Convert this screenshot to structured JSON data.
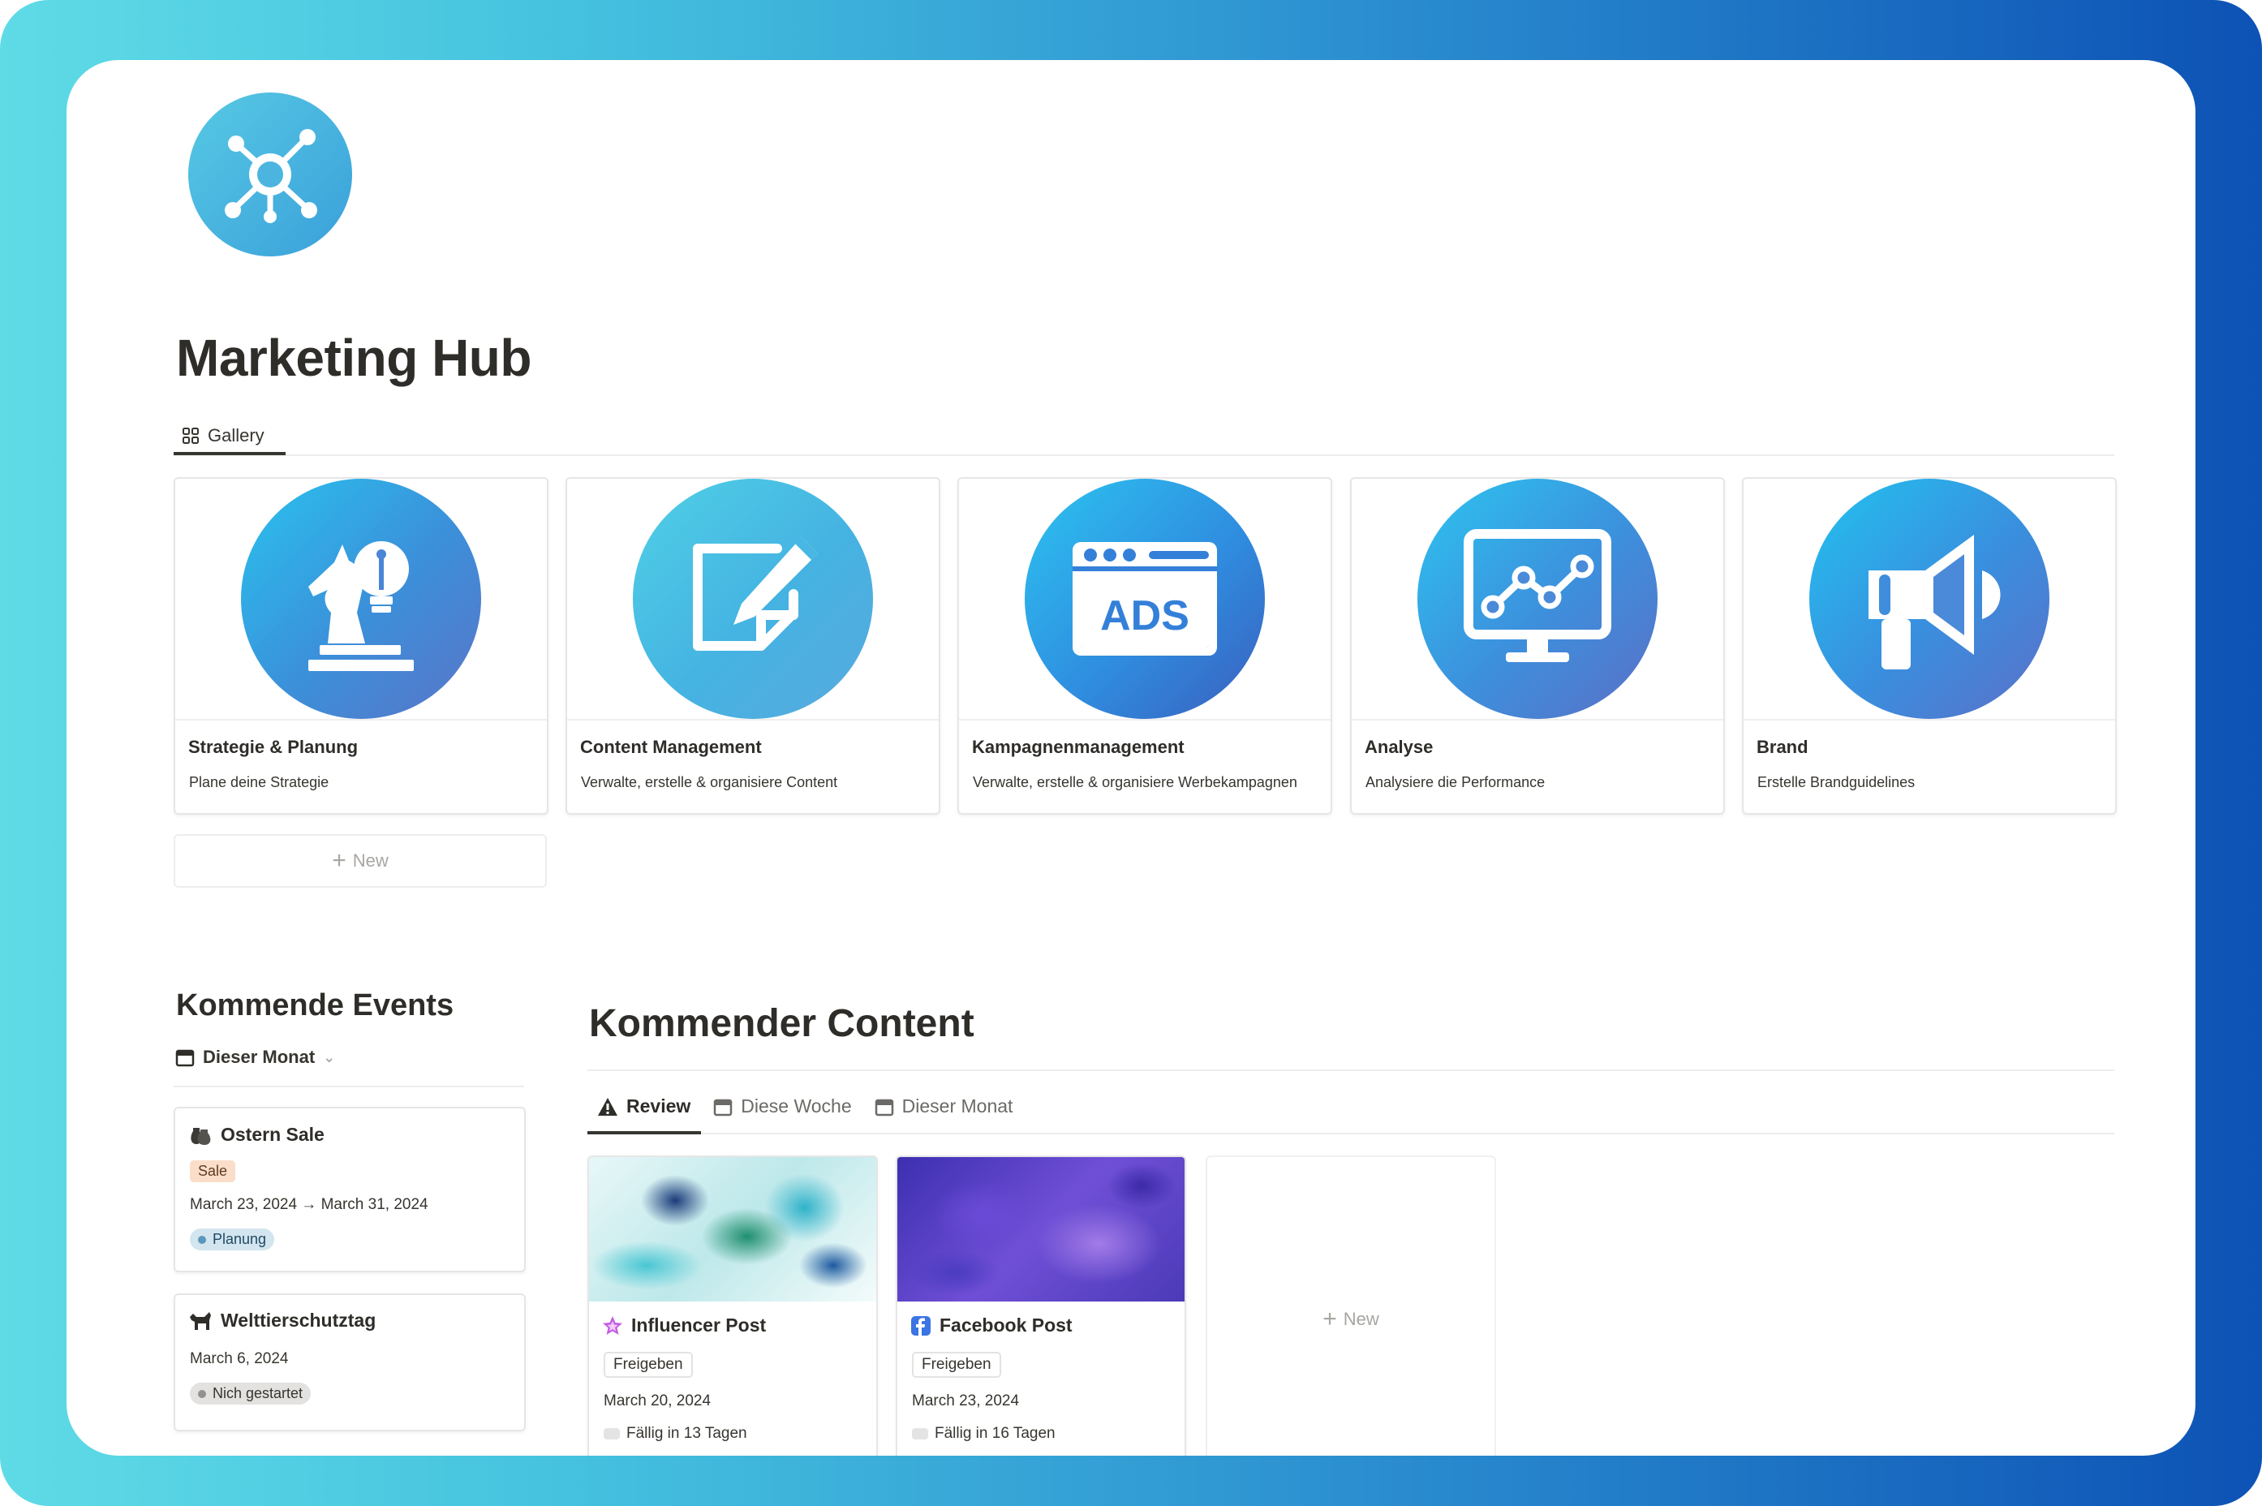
{
  "page": {
    "title": "Marketing Hub",
    "icon": "network-hub-icon"
  },
  "gallery_view": {
    "tab_label": "Gallery",
    "new_label": "New",
    "cards": [
      {
        "title": "Strategie & Planung",
        "description": "Plane deine Strategie",
        "icon": "chess-knight-lightbulb-icon"
      },
      {
        "title": "Content Management",
        "description": "Verwalte, erstelle & organisiere Content",
        "icon": "edit-note-icon"
      },
      {
        "title": "Kampagnenmanagement",
        "description": "Verwalte, erstelle & organisiere Werbekampagnen",
        "icon": "ads-browser-icon"
      },
      {
        "title": "Analyse",
        "description": "Analysiere die Performance",
        "icon": "monitor-chart-icon"
      },
      {
        "title": "Brand",
        "description": "Erstelle Brandguidelines",
        "icon": "megaphone-icon"
      }
    ]
  },
  "events": {
    "title": "Kommende Events",
    "filter_label": "Dieser Monat",
    "items": [
      {
        "name": "Ostern Sale",
        "tag": "Sale",
        "dates": "March 23, 2024 → March 31, 2024",
        "status": "Planung"
      },
      {
        "name": "Welttierschutztag",
        "dates": "March 6, 2024",
        "status": "Nich gestartet"
      }
    ]
  },
  "content": {
    "title": "Kommender Content",
    "tabs": [
      "Review",
      "Diese Woche",
      "Dieser Monat"
    ],
    "new_label": "New",
    "cards": [
      {
        "name": "Influencer Post",
        "status": "Freigeben",
        "date": "March 20, 2024",
        "due": "Fällig in 13 Tagen",
        "icon": "star-icon"
      },
      {
        "name": "Facebook Post",
        "status": "Freigeben",
        "date": "March 23, 2024",
        "due": "Fällig in 16 Tagen",
        "icon": "facebook-icon"
      }
    ]
  },
  "colors": {
    "frame_gradient_start": "#5fdbe6",
    "frame_gradient_end": "#0d52b5",
    "sale_tag_bg": "#fadec9",
    "planung_tag_bg": "#d3e5ef",
    "planung_dot": "#5b97bd",
    "nich_gestartet_bg": "#e3e2e0",
    "nich_gestartet_dot": "#91918e"
  }
}
